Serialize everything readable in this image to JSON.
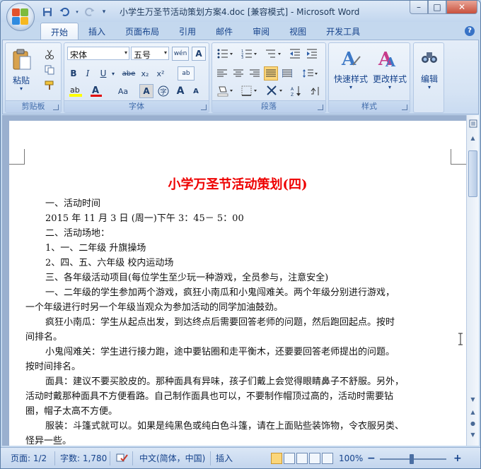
{
  "window": {
    "title": "小学生万圣节活动策划方案4.doc [兼容模式] - Microsoft Word",
    "controls": {
      "minimize": "–",
      "maximize": "□",
      "close": "✕"
    }
  },
  "qat": {
    "save": "save-icon",
    "undo": "undo-icon",
    "redo": "redo-icon",
    "customize": "▾"
  },
  "tabs": [
    "开始",
    "插入",
    "页面布局",
    "引用",
    "邮件",
    "审阅",
    "视图",
    "开发工具"
  ],
  "ribbon": {
    "clipboard": {
      "label": "剪贴板",
      "paste": "粘贴"
    },
    "font": {
      "label": "字体",
      "font_name": "宋体",
      "font_size": "五号",
      "bold": "B",
      "italic": "I",
      "underline": "U",
      "strike": "abe",
      "subscript": "x₂",
      "superscript": "x²",
      "change_case": "Aa",
      "grow": "A",
      "shrink": "A",
      "wen": "wén",
      "highlight_color": "#ffff00",
      "font_color": "#e00000"
    },
    "paragraph": {
      "label": "段落"
    },
    "styles": {
      "label": "样式",
      "quick": "快速样式",
      "change": "更改样式"
    },
    "editing": {
      "label": "编辑"
    }
  },
  "document": {
    "title": "小学万圣节活动策划(四)",
    "lines": [
      "一、活动时间",
      "2015 年 11 月 3 日 (周一)下午 3：45－ 5：00",
      "二、活动场地：",
      "1、一、二年级  升旗操场",
      "2、四、五、六年级  校内运动场",
      "三、各年级活动项目(每位学生至少玩一种游戏，全员参与，注意安全)",
      "一、二年级的学生参加两个游戏，疯狂小南瓜和小鬼闯难关。两个年级分别进行游戏，",
      "一个年级进行时另一个年级当观众为参加活动的同学加油鼓劲。",
      "疯狂小南瓜：学生从起点出发，到达终点后需要回答老师的问题，然后跑回起点。按时",
      "间排名。",
      "小鬼闯难关：学生进行接力跑，途中要钻圈和走平衡木，还要要回答老师提出的问题。",
      "按时间排名。",
      "面具：建议不要买胶皮的。那种面具有异味，孩子们戴上会觉得眼睛鼻子不舒服。另外，",
      "活动时戴那种面具不方便看路。自己制作面具也可以，不要制作帽顶过高的，活动时需要钻",
      "圈，帽子太高不方便。",
      "服装：斗篷式就可以。如果是纯黑色或纯白色斗篷，请在上面贴些装饰物，令衣服另类、",
      "怪异一些。"
    ]
  },
  "status": {
    "page": "页面: 1/2",
    "words": "字数: 1,780",
    "language": "中文(简体，中国)",
    "mode": "插入",
    "zoom": "100%",
    "zoom_minus": "−",
    "zoom_plus": "+"
  }
}
